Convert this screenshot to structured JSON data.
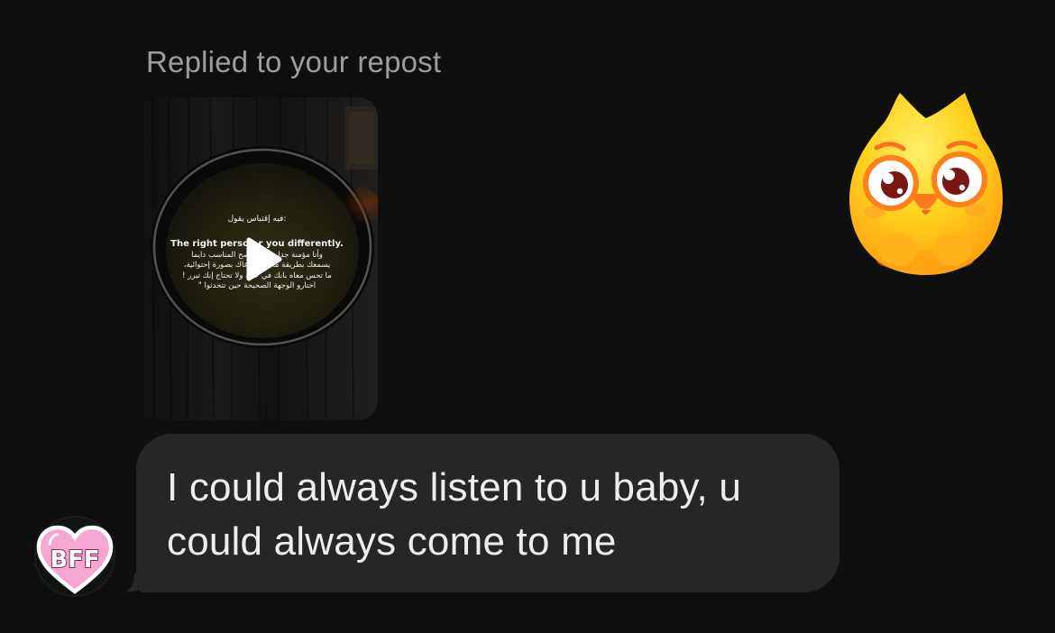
{
  "thread": {
    "reply_context": "Replied to your repost"
  },
  "repost_card": {
    "overlay_header": "فيه إقتباس يقول:",
    "overlay_english": "The right person          r you differently.",
    "overlay_arabic": [
      "وأنا مؤمنة جدا بصـ         ل الصح المناسب دايما",
      "يسمعك بطريقة مختلفة و        عاك بصورة إحتوائية،",
      "ما تحس معاه بانك في خالة         ولا تحتاج إنك تبرر !",
      "اختارو الوجهة الصحيحة حين تتحدثوا \""
    ],
    "play_icon": "play-icon"
  },
  "message": {
    "text": "I could always listen to u baby, u could always come to me"
  },
  "avatar": {
    "label": "BFF",
    "icon": "heart-bff-avatar-icon"
  },
  "sticker": {
    "icon": "cute-yellow-creature-sticker-icon"
  },
  "colors": {
    "background": "#0f0f0f",
    "bubble": "#262626",
    "text_primary": "#ededed",
    "text_secondary": "#9d9d9d",
    "avatar_pink": "#f7a6d2",
    "sticker_yellow": "#ffd21f",
    "sticker_orange": "#ff9a16"
  }
}
